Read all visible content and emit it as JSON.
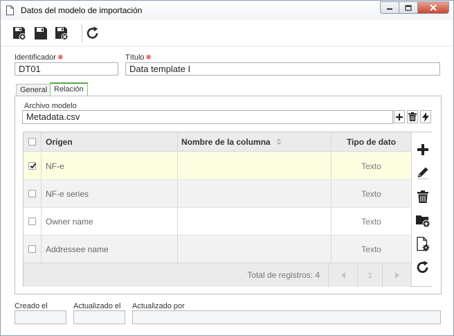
{
  "window": {
    "title": "Datos del modelo de importación"
  },
  "form": {
    "identifier_label": "Identificador",
    "identifier_value": "DT01",
    "title_label": "Título",
    "title_value": "Data template I",
    "required_mark": "❋"
  },
  "tabs": [
    {
      "label": "General",
      "active": false
    },
    {
      "label": "Relación",
      "active": true
    }
  ],
  "relation": {
    "file_label": "Archivo modelo",
    "file_value": "Metadata.csv",
    "columns": [
      "Origen",
      "Nombre de la columna",
      "Tipo de dato"
    ],
    "rows": [
      {
        "origin": "NF-e",
        "column_name": "",
        "data_type": "Texto",
        "checked": true
      },
      {
        "origin": "NF-e series",
        "column_name": "",
        "data_type": "Texto",
        "checked": false
      },
      {
        "origin": "Owner name",
        "column_name": "",
        "data_type": "Texto",
        "checked": false
      },
      {
        "origin": "Addressee name",
        "column_name": "",
        "data_type": "Texto",
        "checked": false
      }
    ],
    "total_records": "Total de registros: 4",
    "page": "1"
  },
  "footer": {
    "created_label": "Creado el",
    "updated_label": "Actualizado el",
    "updated_by_label": "Actualizado por",
    "created_value": "",
    "updated_value": "",
    "updated_by_value": ""
  },
  "colors": {
    "selected_row": "#fdfde0",
    "alt_row": "#f2f2f2",
    "active_tab_accent": "#5aa546",
    "required": "#e0301e"
  }
}
